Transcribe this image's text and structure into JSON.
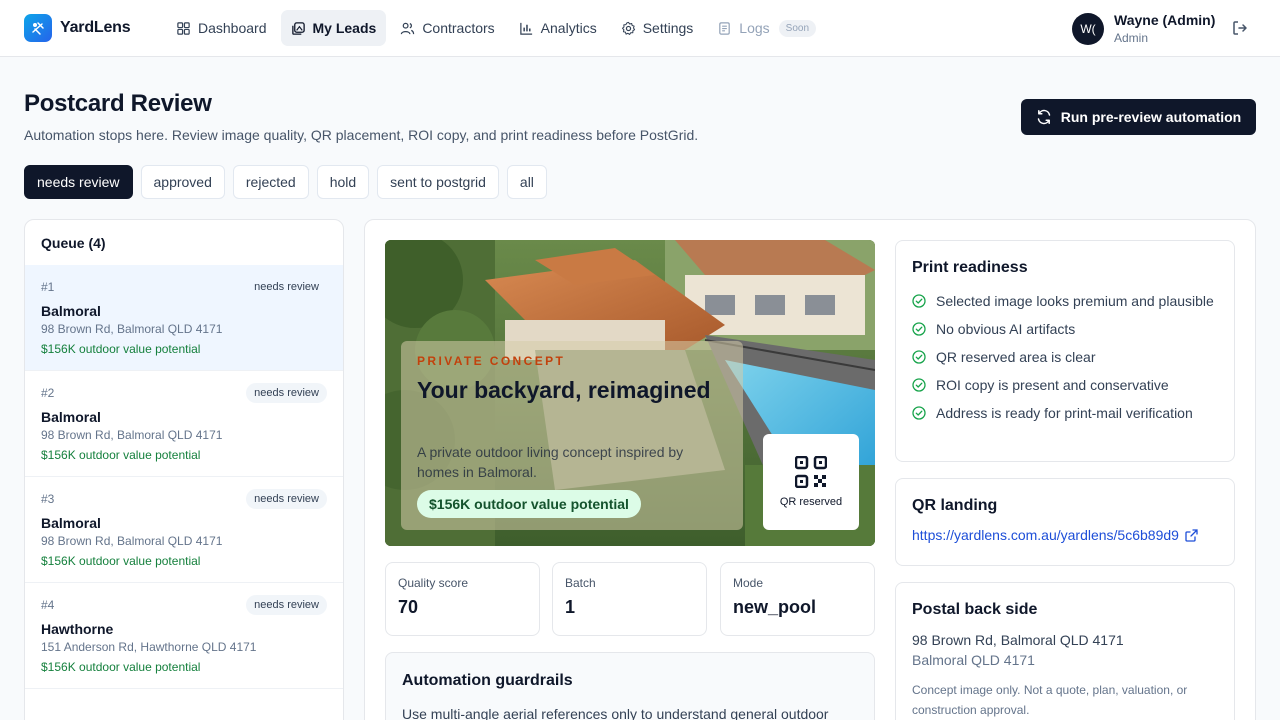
{
  "app": {
    "name": "YardLens"
  },
  "nav": {
    "items": [
      {
        "label": "Dashboard",
        "icon": "grid-icon"
      },
      {
        "label": "My Leads",
        "icon": "leads-icon"
      },
      {
        "label": "Contractors",
        "icon": "users-icon"
      },
      {
        "label": "Analytics",
        "icon": "bar-chart-icon"
      },
      {
        "label": "Settings",
        "icon": "gear-icon"
      },
      {
        "label": "Logs",
        "icon": "logs-icon",
        "badge": "Soon"
      }
    ],
    "active": "My Leads"
  },
  "user": {
    "initials": "W(",
    "name": "Wayne (Admin)",
    "role": "Admin"
  },
  "header": {
    "title": "Postcard Review",
    "subtitle": "Automation stops here. Review image quality, QR placement, ROI copy, and print readiness before PostGrid.",
    "run_button": "Run pre-review automation"
  },
  "filters": [
    "needs review",
    "approved",
    "rejected",
    "hold",
    "sent to postgrid",
    "all"
  ],
  "queue": {
    "title": "Queue (4)",
    "items": [
      {
        "num": "#1",
        "status": "needs review",
        "name": "Balmoral",
        "address": "98 Brown Rd, Balmoral QLD 4171",
        "value": "$156K outdoor value potential"
      },
      {
        "num": "#2",
        "status": "needs review",
        "name": "Balmoral",
        "address": "98 Brown Rd, Balmoral QLD 4171",
        "value": "$156K outdoor value potential"
      },
      {
        "num": "#3",
        "status": "needs review",
        "name": "Balmoral",
        "address": "98 Brown Rd, Balmoral QLD 4171",
        "value": "$156K outdoor value potential"
      },
      {
        "num": "#4",
        "status": "needs review",
        "name": "Hawthorne",
        "address": "151 Anderson Rd, Hawthorne QLD 4171",
        "value": "$156K outdoor value potential"
      }
    ]
  },
  "postcard": {
    "eyebrow": "PRIVATE CONCEPT",
    "headline": "Your backyard, reimagined",
    "body": "A private outdoor living concept inspired by homes in Balmoral.",
    "chip": "$156K outdoor value potential",
    "qr_label": "QR reserved"
  },
  "stats": [
    {
      "label": "Quality score",
      "value": "70"
    },
    {
      "label": "Batch",
      "value": "1"
    },
    {
      "label": "Mode",
      "value": "new_pool"
    }
  ],
  "guardrails": {
    "title": "Automation guardrails",
    "text": "Use multi-angle aerial references only to understand general outdoor"
  },
  "print_readiness": {
    "title": "Print readiness",
    "items": [
      "Selected image looks premium and plausible",
      "No obvious AI artifacts",
      "QR reserved area is clear",
      "ROI copy is present and conservative",
      "Address is ready for print-mail verification"
    ]
  },
  "qr_landing": {
    "title": "QR landing",
    "url": "https://yardlens.com.au/yardlens/5c6b89d9"
  },
  "postal": {
    "title": "Postal back side",
    "line1": "98 Brown Rd, Balmoral QLD 4171",
    "line2": "Balmoral QLD 4171",
    "note": "Concept image only. Not a quote, plan, valuation, or construction approval."
  },
  "colors": {
    "primary": "#0f172a",
    "accent": "#2563eb",
    "success": "#15803d",
    "check": "#16a34a"
  }
}
